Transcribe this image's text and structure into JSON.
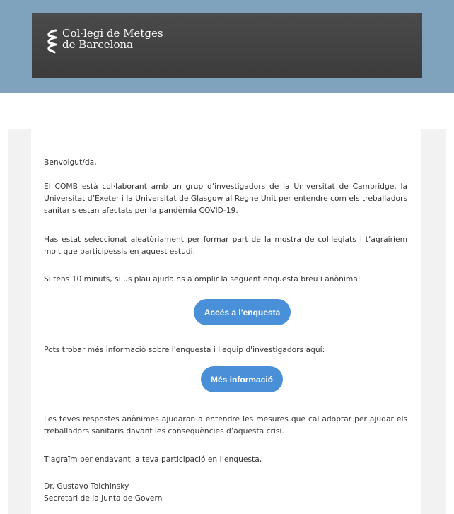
{
  "header": {
    "logo_line1": "Col·legi de Metges",
    "logo_line2": "de Barcelona"
  },
  "email": {
    "greeting": "Benvolgut/da,",
    "para1": "El COMB està col·laborant amb un grup d’investigadors de la Universitat de Cambridge, la Universitat d’Exeter i la Universitat de Glasgow al Regne Unit per entendre com els treballadors sanitaris estan afectats per la pandèmia COVID-19.",
    "para2": "Has estat seleccionat aleatòriament per formar part de la mostra de col·legiats i t’agrairíem molt que participessis en aquest estudi.",
    "para3": "Si tens 10 minuts, si us plau ajuda’ns a omplir la següent enquesta breu i anònima:",
    "survey_button": "Accés a l'enquesta",
    "para4": "Pots trobar més informació sobre l'enquesta i l'equip d'investigadors aquí:",
    "info_button": "Més informació",
    "para5": "Les teves respostes anònimes ajudaran a entendre les mesures que cal adoptar per ajudar els treballadors sanitaris davant les conseqüències d’aquesta crisi.",
    "closing": "T’agraïm per endavant la teva participació en l’enquesta,",
    "signature_name": "Dr. Gustavo Tolchinsky",
    "signature_title": "Secretari de la Junta de Govern"
  },
  "colors": {
    "header_band": "#7fa3bd",
    "header_inner": "#404040",
    "button": "#4a90d9",
    "content_bg": "#f2f2f2"
  }
}
